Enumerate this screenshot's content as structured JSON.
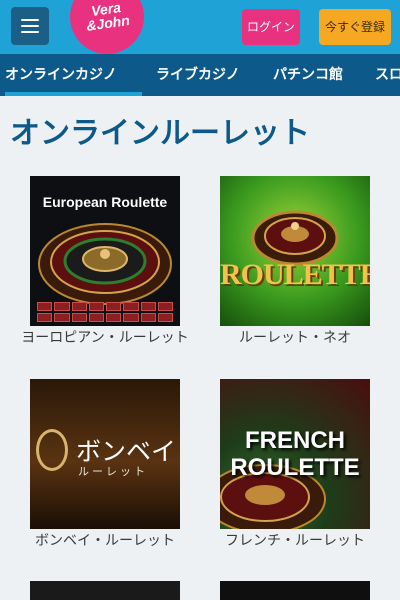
{
  "header": {
    "logo_line1": "Vera",
    "logo_line2": "&John",
    "login_label": "ログイン",
    "register_label": "今すぐ登録"
  },
  "nav": {
    "categories": [
      {
        "label": "オンラインカジノ",
        "active": true
      },
      {
        "label": "ライブカジノ"
      },
      {
        "label": "パチンコ館"
      },
      {
        "label": "スロ"
      }
    ]
  },
  "page": {
    "title": "オンラインルーレット"
  },
  "games": [
    {
      "caption": "ヨーロピアン・ルーレット",
      "thumb_text": "European Roulette"
    },
    {
      "caption": "ルーレット・ネオ",
      "thumb_text": "ROULETTE"
    },
    {
      "caption": "ボンベイ・ルーレット",
      "thumb_text": "ボンベイ",
      "thumb_subtext": "ルーレット"
    },
    {
      "caption": "フレンチ・ルーレット",
      "thumb_text_line1": "FRENCH",
      "thumb_text_line2": "ROULETTE"
    }
  ],
  "colors": {
    "header_bg": "#1fa3d6",
    "nav_bg": "#0d5a8a",
    "brand_pink": "#e8317f",
    "cta_orange": "#f7a823",
    "title_blue": "#0d5a8a"
  },
  "icons": {
    "menu": "hamburger-menu-icon",
    "logo": "vera-john-logo"
  }
}
